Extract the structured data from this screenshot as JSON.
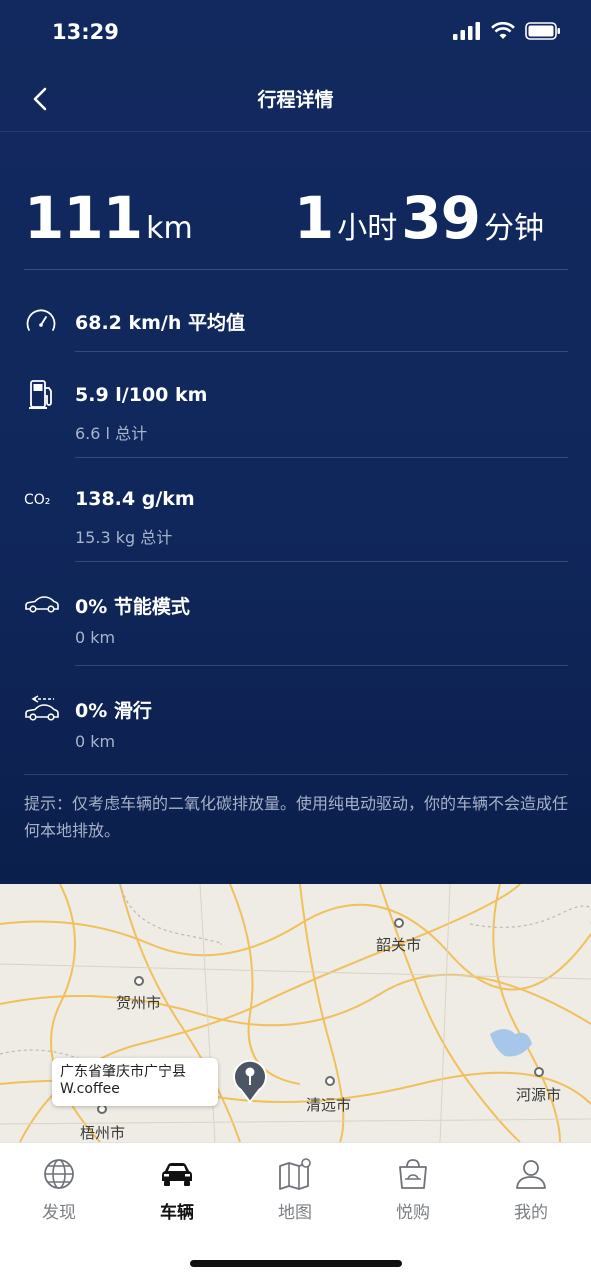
{
  "status_bar": {
    "time": "13:29"
  },
  "header": {
    "title": "行程详情"
  },
  "summary": {
    "distance_value": "111",
    "distance_unit": "km",
    "hours_value": "1",
    "hours_unit": "小时",
    "minutes_value": "39",
    "minutes_unit": "分钟"
  },
  "stats": [
    {
      "icon": "speedometer-icon",
      "main": "68.2 km/h 平均值",
      "sub": ""
    },
    {
      "icon": "fuel-pump-icon",
      "main": "5.9 l/100 km",
      "sub": "6.6 l 总计"
    },
    {
      "icon": "co2-icon",
      "icon_text": "CO₂",
      "main": "138.4 g/km",
      "sub": "15.3 kg 总计"
    },
    {
      "icon": "eco-car-icon",
      "main": "0% 节能模式",
      "sub": "0 km"
    },
    {
      "icon": "coasting-car-icon",
      "main": "0% 滑行",
      "sub": "0 km"
    }
  ],
  "tip": "提示：仅考虑车辆的二氧化碳排放量。使用纯电动驱动，你的车辆不会造成任何本地排放。",
  "map": {
    "cities": [
      "韶关市",
      "贺州市",
      "清远市",
      "河源市",
      "梧州市"
    ],
    "callout_line1": "广东省肇庆市广宁县",
    "callout_line2": "W.coffee"
  },
  "tabbar": {
    "items": [
      {
        "label": "发现",
        "icon": "globe-icon"
      },
      {
        "label": "车辆",
        "icon": "car-icon"
      },
      {
        "label": "地图",
        "icon": "map-icon"
      },
      {
        "label": "悦购",
        "icon": "shopping-bag-icon"
      },
      {
        "label": "我的",
        "icon": "person-icon"
      }
    ],
    "active": "车辆"
  },
  "colors": {
    "header_bg": "#12295f",
    "text_secondary": "#a9b4cc",
    "map_bg": "#eeece4",
    "road": "#f2b945"
  }
}
